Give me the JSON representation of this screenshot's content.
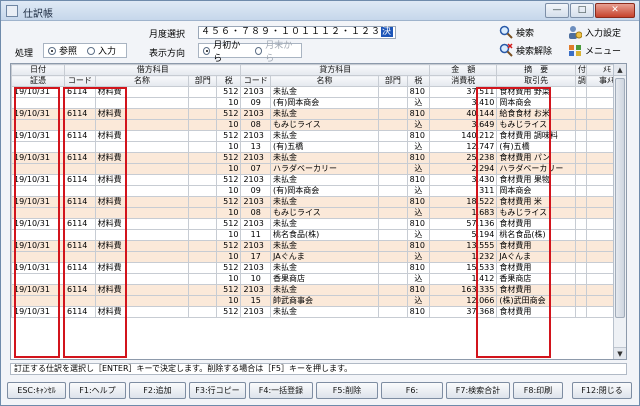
{
  "window": {
    "title": "仕訳帳"
  },
  "toolbar": {
    "month_label": "月度選択",
    "months": "４５６・７８９・１０１１１２・１２３",
    "month_selected": "決",
    "mode_label": "処理",
    "mode_options": [
      "参照",
      "入力"
    ],
    "direction_label": "表示方向",
    "direction_options": [
      "月初から",
      "月末から"
    ],
    "search": "検索",
    "search_clear": "検索解除",
    "input_settings": "入力設定",
    "menu": "メニュー"
  },
  "table": {
    "header_row1": [
      "日付",
      "借方科目",
      "貸方科目",
      "金　額",
      "摘　要",
      "付",
      "ﾒﾓ"
    ],
    "header_row2": [
      "証憑",
      "コード",
      "名称",
      "部門",
      "税",
      "コード",
      "名称",
      "部門",
      "税",
      "消費税",
      "取引先",
      "調",
      "事ﾒﾓ"
    ],
    "entries": [
      {
        "date": "19/10/31",
        "debit_code": "6114",
        "debit_name": "材料費",
        "tax1": "512",
        "credit_code": "2103",
        "credit_name": "未払金",
        "credit_tax": "810",
        "amount": "37,511",
        "memo": "食材費用 野菜",
        "sub_tax1": "10",
        "sub_code": "09",
        "sub_name": "(有)岡本商会",
        "incl": "込",
        "tax": "3,410",
        "partner": "岡本商会"
      },
      {
        "date": "19/10/31",
        "debit_code": "6114",
        "debit_name": "材料費",
        "tax1": "512",
        "credit_code": "2103",
        "credit_name": "未払金",
        "credit_tax": "810",
        "amount": "40,144",
        "memo": "給食食材 お米",
        "sub_tax1": "10",
        "sub_code": "08",
        "sub_name": "もみじライス",
        "incl": "込",
        "tax": "3,649",
        "partner": "もみじライス"
      },
      {
        "date": "19/10/31",
        "debit_code": "6114",
        "debit_name": "材料費",
        "tax1": "512",
        "credit_code": "2103",
        "credit_name": "未払金",
        "credit_tax": "810",
        "amount": "140,212",
        "memo": "食材費用 調味料",
        "sub_tax1": "10",
        "sub_code": "13",
        "sub_name": "(有)五橋",
        "incl": "込",
        "tax": "12,747",
        "partner": "(有)五橋"
      },
      {
        "date": "19/10/31",
        "debit_code": "6114",
        "debit_name": "材料費",
        "tax1": "512",
        "credit_code": "2103",
        "credit_name": "未払金",
        "credit_tax": "810",
        "amount": "25,238",
        "memo": "食材費用 パン",
        "sub_tax1": "10",
        "sub_code": "07",
        "sub_name": "ハラダベーカリー",
        "incl": "込",
        "tax": "2,294",
        "partner": "ハラダベーカリー"
      },
      {
        "date": "19/10/31",
        "debit_code": "6114",
        "debit_name": "材料費",
        "tax1": "512",
        "credit_code": "2103",
        "credit_name": "未払金",
        "credit_tax": "810",
        "amount": "3,430",
        "memo": "食材費用 果物",
        "sub_tax1": "10",
        "sub_code": "09",
        "sub_name": "(有)岡本商会",
        "incl": "込",
        "tax": "311",
        "partner": "岡本商会"
      },
      {
        "date": "19/10/31",
        "debit_code": "6114",
        "debit_name": "材料費",
        "tax1": "512",
        "credit_code": "2103",
        "credit_name": "未払金",
        "credit_tax": "810",
        "amount": "18,522",
        "memo": "食材費用 米",
        "sub_tax1": "10",
        "sub_code": "08",
        "sub_name": "もみじライス",
        "incl": "込",
        "tax": "1,683",
        "partner": "もみじライス"
      },
      {
        "date": "19/10/31",
        "debit_code": "6114",
        "debit_name": "材料費",
        "tax1": "512",
        "credit_code": "2103",
        "credit_name": "未払金",
        "credit_tax": "810",
        "amount": "57,136",
        "memo": "食材費用",
        "sub_tax1": "10",
        "sub_code": "11",
        "sub_name": "桃名食品(株)",
        "incl": "込",
        "tax": "5,194",
        "partner": "桃名食品(株)"
      },
      {
        "date": "19/10/31",
        "debit_code": "6114",
        "debit_name": "材料費",
        "tax1": "512",
        "credit_code": "2103",
        "credit_name": "未払金",
        "credit_tax": "810",
        "amount": "13,555",
        "memo": "食材費用",
        "sub_tax1": "10",
        "sub_code": "17",
        "sub_name": "JAぐんま",
        "incl": "込",
        "tax": "1,232",
        "partner": "JAぐんま"
      },
      {
        "date": "19/10/31",
        "debit_code": "6114",
        "debit_name": "材料費",
        "tax1": "512",
        "credit_code": "2103",
        "credit_name": "未払金",
        "credit_tax": "810",
        "amount": "15,533",
        "memo": "食材費用",
        "sub_tax1": "10",
        "sub_code": "10",
        "sub_name": "香果商店",
        "incl": "込",
        "tax": "1,412",
        "partner": "香果商店"
      },
      {
        "date": "19/10/31",
        "debit_code": "6114",
        "debit_name": "材料費",
        "tax1": "512",
        "credit_code": "2103",
        "credit_name": "未払金",
        "credit_tax": "810",
        "amount": "163,335",
        "memo": "食材費用",
        "sub_tax1": "10",
        "sub_code": "15",
        "sub_name": "帥武商事会",
        "incl": "込",
        "tax": "12,066",
        "partner": "(株)武田商会"
      },
      {
        "date": "19/10/31",
        "debit_code": "6114",
        "debit_name": "材料費",
        "tax1": "512",
        "credit_code": "2103",
        "credit_name": "未払金",
        "credit_tax": "810",
        "amount": "37,368",
        "memo": "食材費用"
      }
    ]
  },
  "status_text": "訂正する仕訳を選択し［ENTER］キーで決定します。削除する場合は［F5］キーを押します。",
  "function_keys": [
    "ESC:ｷｬﾝｾﾙ",
    "F1:ヘルプ",
    "F2:追加",
    "F3:行コピー",
    "F4:一括登録",
    "F5:削除",
    "F6:",
    "F7:検索合計",
    "F8:印刷",
    "F12:閉じる"
  ]
}
